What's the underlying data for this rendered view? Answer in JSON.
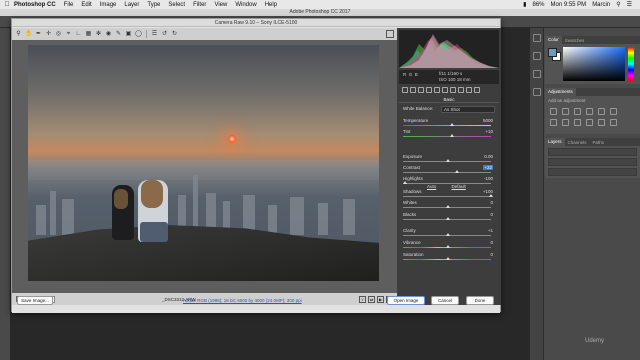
{
  "menubar": {
    "apple": "",
    "app": "Photoshop CC",
    "items": [
      "File",
      "Edit",
      "Image",
      "Layer",
      "Type",
      "Select",
      "Filter",
      "View",
      "Window",
      "Help"
    ],
    "battery": "86%",
    "clock": "Mon 9:55 PM",
    "user": "Marcin"
  },
  "ps_title": "Adobe Photoshop CC 2017",
  "camera_raw": {
    "title": "Camera Raw 9.10  –  Sony ILCE-5100",
    "status": {
      "zoom": "31.1%",
      "filename": "_DSC3312.ARW"
    },
    "exif": {
      "aperture_shutter": "f/11   1/160 s",
      "iso_focal": "ISO 100   18 mm"
    },
    "panel_title": "Basic",
    "white_balance": {
      "label": "White Balance:",
      "value": "As Shot"
    },
    "sliders": [
      {
        "label": "Temperature",
        "value": "5000",
        "pos": 0.55
      },
      {
        "label": "Tint",
        "value": "+10",
        "pos": 0.55
      },
      {
        "label": "Exposure",
        "value": "0.00",
        "pos": 0.5
      },
      {
        "label": "Contrast",
        "value": "+22",
        "pos": 0.61,
        "highlight": true
      },
      {
        "label": "Highlights",
        "value": "-100",
        "pos": 0.0
      },
      {
        "label": "Shadows",
        "value": "+100",
        "pos": 1.0
      },
      {
        "label": "Whites",
        "value": "0",
        "pos": 0.5
      },
      {
        "label": "Blacks",
        "value": "0",
        "pos": 0.5
      },
      {
        "label": "Clarity",
        "value": "+1",
        "pos": 0.5
      },
      {
        "label": "Vibrance",
        "value": "0",
        "pos": 0.5
      },
      {
        "label": "Saturation",
        "value": "0",
        "pos": 0.5
      }
    ],
    "auto": "Auto",
    "default": "Default",
    "workflow_link": "Adobe RGB (1998); 16 bit; 6000 by 4000 (24.0MP); 300 ppi",
    "buttons": {
      "save": "Save Image...",
      "open": "Open Image",
      "cancel": "Cancel",
      "done": "Done"
    }
  },
  "right_panels": {
    "color_tabs": [
      "Color",
      "Swatches"
    ],
    "adjustments_tab": "Adjustments",
    "adjustments_sub": "Add an adjustment",
    "layers_tabs": [
      "Layers",
      "Channels",
      "Paths"
    ]
  },
  "watermark": "Udemy"
}
